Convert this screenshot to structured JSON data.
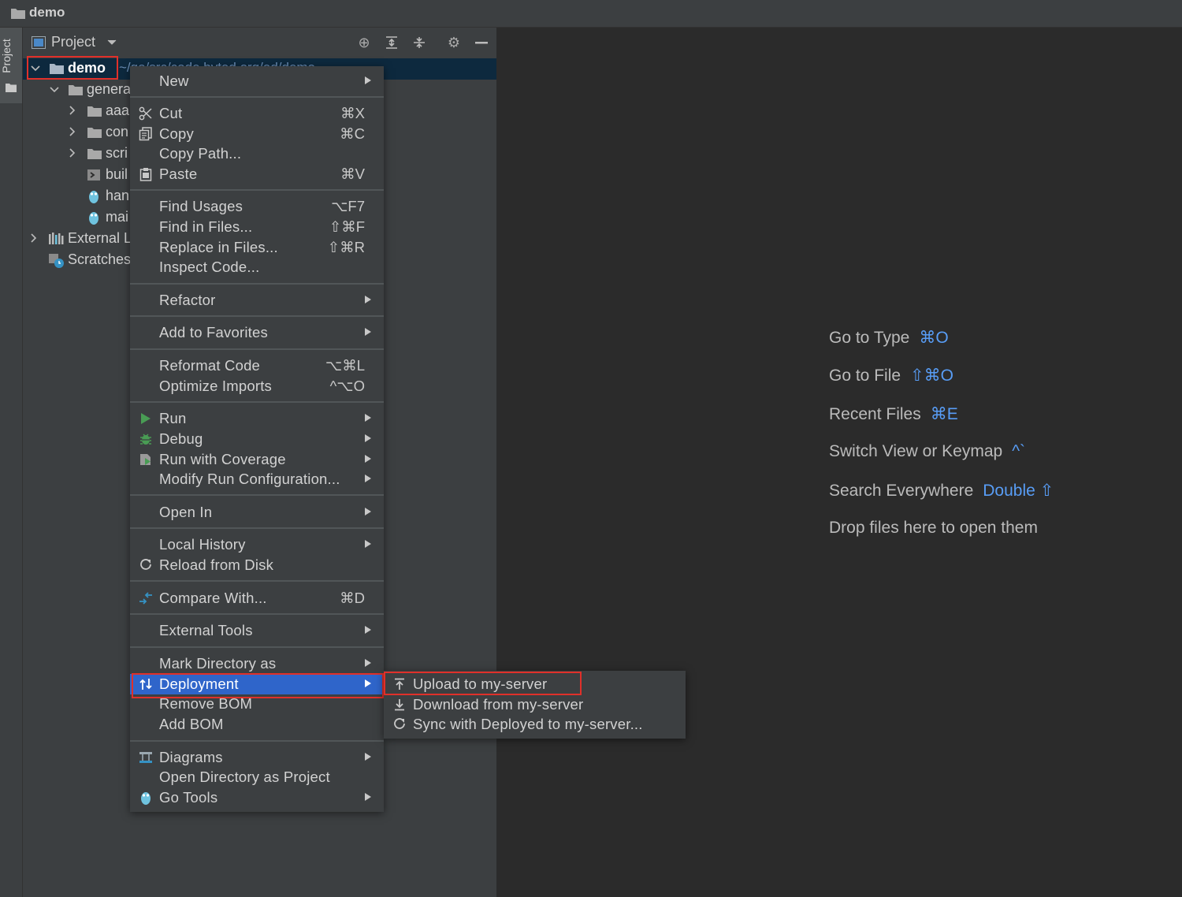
{
  "titlebar": {
    "title": "demo"
  },
  "sidebar": {
    "project_tab": "Project"
  },
  "panel": {
    "title": "Project",
    "tree": [
      {
        "label": "demo",
        "path": "~/go/src/code.byted.org/ad/demo"
      },
      {
        "label": "genera"
      },
      {
        "label": "aaa"
      },
      {
        "label": "con"
      },
      {
        "label": "scri"
      },
      {
        "label": "buil"
      },
      {
        "label": "han"
      },
      {
        "label": "mai"
      },
      {
        "label": "External L"
      },
      {
        "label": "Scratches"
      }
    ]
  },
  "context_menu": {
    "items": [
      {
        "label": "New",
        "shortcut": ""
      },
      {
        "label": "Cut",
        "shortcut": "⌘X"
      },
      {
        "label": "Copy",
        "shortcut": "⌘C"
      },
      {
        "label": "Copy Path...",
        "shortcut": ""
      },
      {
        "label": "Paste",
        "shortcut": "⌘V"
      },
      {
        "label": "Find Usages",
        "shortcut": "⌥F7"
      },
      {
        "label": "Find in Files...",
        "shortcut": "⇧⌘F"
      },
      {
        "label": "Replace in Files...",
        "shortcut": "⇧⌘R"
      },
      {
        "label": "Inspect Code...",
        "shortcut": ""
      },
      {
        "label": "Refactor",
        "shortcut": ""
      },
      {
        "label": "Add to Favorites",
        "shortcut": ""
      },
      {
        "label": "Reformat Code",
        "shortcut": "⌥⌘L"
      },
      {
        "label": "Optimize Imports",
        "shortcut": "^⌥O"
      },
      {
        "label": "Run",
        "shortcut": ""
      },
      {
        "label": "Debug",
        "shortcut": ""
      },
      {
        "label": "Run with Coverage",
        "shortcut": ""
      },
      {
        "label": "Modify Run Configuration...",
        "shortcut": ""
      },
      {
        "label": "Open In",
        "shortcut": ""
      },
      {
        "label": "Local History",
        "shortcut": ""
      },
      {
        "label": "Reload from Disk",
        "shortcut": ""
      },
      {
        "label": "Compare With...",
        "shortcut": "⌘D"
      },
      {
        "label": "External Tools",
        "shortcut": ""
      },
      {
        "label": "Mark Directory as",
        "shortcut": ""
      },
      {
        "label": "Deployment",
        "shortcut": ""
      },
      {
        "label": "Remove BOM",
        "shortcut": ""
      },
      {
        "label": "Add BOM",
        "shortcut": ""
      },
      {
        "label": "Diagrams",
        "shortcut": ""
      },
      {
        "label": "Open Directory as Project",
        "shortcut": ""
      },
      {
        "label": "Go Tools",
        "shortcut": ""
      }
    ]
  },
  "submenu": {
    "items": [
      {
        "label": "Upload to my-server"
      },
      {
        "label": "Download from my-server"
      },
      {
        "label": "Sync with Deployed to my-server..."
      }
    ]
  },
  "welcome": [
    {
      "label": "Go to Type",
      "key": "⌘O"
    },
    {
      "label": "Go to File",
      "key": "⇧⌘O"
    },
    {
      "label": "Recent Files",
      "key": "⌘E"
    },
    {
      "label": "Switch View or Keymap",
      "key": "^`"
    },
    {
      "label": "Search Everywhere",
      "key": "Double ⇧"
    },
    {
      "label": "Drop files here to open them",
      "key": ""
    }
  ],
  "colors": {
    "accent": "#2f65ca",
    "highlight_box": "#e0302a",
    "shortcut_key": "#589df6"
  }
}
